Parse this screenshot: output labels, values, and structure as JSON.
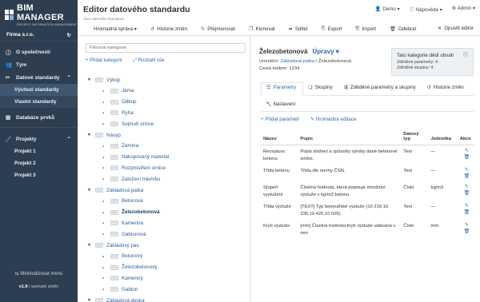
{
  "brand": {
    "name": "BIM MANAGER",
    "subtitle": "PROJECT INFORMATION MANAGEMENT"
  },
  "firm": {
    "name": "Firma s.r.o.",
    "icon": "refresh-icon"
  },
  "sidebar": {
    "items": [
      {
        "label": "O společnosti",
        "icon": "info-icon"
      },
      {
        "label": "Tým",
        "icon": "users-icon"
      },
      {
        "label": "Datové standardy",
        "icon": "wrench-icon"
      }
    ],
    "standards": [
      "Výchozí standardy",
      "Vlastní standardy"
    ],
    "database": "Databáze prvků",
    "projects_label": "Projekty",
    "projects": [
      "Projekt 1",
      "Projekt 2",
      "Projekt 3"
    ],
    "minimize": "Minimalizovat menu",
    "version": "v1.9",
    "changes": "seznam změn"
  },
  "header": {
    "title": "Editor datového standardu",
    "breadcrumb": "Akce datového standardu",
    "user_menu": [
      "Demo",
      "Nápověda",
      "Admin"
    ],
    "toolbar": [
      "Hromadná správa",
      "Historie změn",
      "Přejmenovat",
      "Klonovat",
      "Sdílet",
      "Export",
      "Import",
      "Odebrat"
    ],
    "exit": "Opustit editor"
  },
  "tree": {
    "filter_placeholder": "Filtrovat kategorie",
    "add": "Přidat kategorii",
    "expand": "Rozbalit vše",
    "dots": "···",
    "nodes": [
      {
        "label": "Výkop",
        "level": 0
      },
      {
        "label": "Jáma",
        "level": 1
      },
      {
        "label": "Odkop",
        "level": 1
      },
      {
        "label": "Rýha",
        "level": 1
      },
      {
        "label": "Sejmutí ornice",
        "level": 1
      },
      {
        "label": "Násyp",
        "level": 0
      },
      {
        "label": "Zemina",
        "level": 1
      },
      {
        "label": "Nakupovaný materiál",
        "level": 1
      },
      {
        "label": "Rozprostření ornice",
        "level": 1
      },
      {
        "label": "Založení trávníku",
        "level": 1
      },
      {
        "label": "Základová patka",
        "level": 0
      },
      {
        "label": "Betonová",
        "level": 1
      },
      {
        "label": "Železobetonová",
        "level": 1
      },
      {
        "label": "Kamenná",
        "level": 1
      },
      {
        "label": "Gabionová",
        "level": 1
      },
      {
        "label": "Základový pas",
        "level": 0
      },
      {
        "label": "Betonový",
        "level": 1
      },
      {
        "label": "Železobetonový",
        "level": 1
      },
      {
        "label": "Kamenný",
        "level": 1
      },
      {
        "label": "Gabion",
        "level": 1
      },
      {
        "label": "Základová deska",
        "level": 0
      }
    ],
    "selected": "Železobetonová"
  },
  "detail": {
    "title": "Železobetonová",
    "edit": "Úpravy",
    "location_label": "Umístění:",
    "location_parent": "Základová patka",
    "location_self": "/ Železobetonová",
    "code_label": "Cesta kódem:",
    "code": "1234",
    "inherit_title": "Tato kategorie dědí obsah",
    "inherit_params": "Zděděné parametry: 4",
    "inherit_groups": "Zděděné skupiny: 4",
    "tabs": [
      "Parametry",
      "Skupiny",
      "Zděděné parametry a skupiny",
      "Historie změn"
    ],
    "settings_tab": "Nastavení",
    "add_param": "Přidat parametr",
    "bulk_edit": "Hromadná editace"
  },
  "table": {
    "headers": [
      "Název",
      "Popis",
      "Datový typ",
      "Jednotka",
      "Akce"
    ],
    "rows": [
      {
        "name": "Receptura betonu",
        "desc": "Popis složení a způsoby výroby dané betonové směsi.",
        "type": "Text",
        "unit": "—"
      },
      {
        "name": "Třída betonu",
        "desc": "Třída dle normy ČSN.",
        "type": "Text",
        "unit": "—"
      },
      {
        "name": "Stupeň vyztužení",
        "desc": "Číselná hodnota, která popisuje množství výztuže v kg/m3 betonu.",
        "type": "Číslo",
        "unit": "kg/m3"
      },
      {
        "name": "Třída výztuže",
        "desc": "[TEXT] Typ betonářské výztuže (10 216;10 335;10 425;10 505)",
        "type": "Text",
        "unit": "—"
      },
      {
        "name": "Krytí výztuže",
        "desc": "[mm] Číselná hodnota krytí výztuže udávaná v mm",
        "type": "Číslo",
        "unit": "mm"
      }
    ]
  },
  "colors": {
    "sidebar": "#2d3e50",
    "accent": "#2b6cb0"
  }
}
